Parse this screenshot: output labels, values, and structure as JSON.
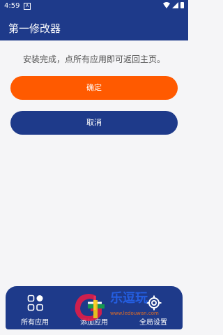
{
  "status": {
    "time": "4:59",
    "a_badge": "A"
  },
  "app": {
    "title": "第一修改器"
  },
  "message": "安装完成，点所有应用即可返回主页。",
  "buttons": {
    "confirm": "确定",
    "cancel": "取消"
  },
  "nav": {
    "items": [
      {
        "label": "所有应用",
        "icon": "apps-grid-icon"
      },
      {
        "label": "添加应用",
        "icon": "add-icon"
      },
      {
        "label": "全局设置",
        "icon": "gear-icon"
      }
    ]
  },
  "watermark": {
    "text": "乐逗玩",
    "site": "www.ledouwan.com"
  },
  "colors": {
    "primary": "#1e3a8a",
    "accent": "#ff5a00",
    "background": "#f5f5f7"
  }
}
